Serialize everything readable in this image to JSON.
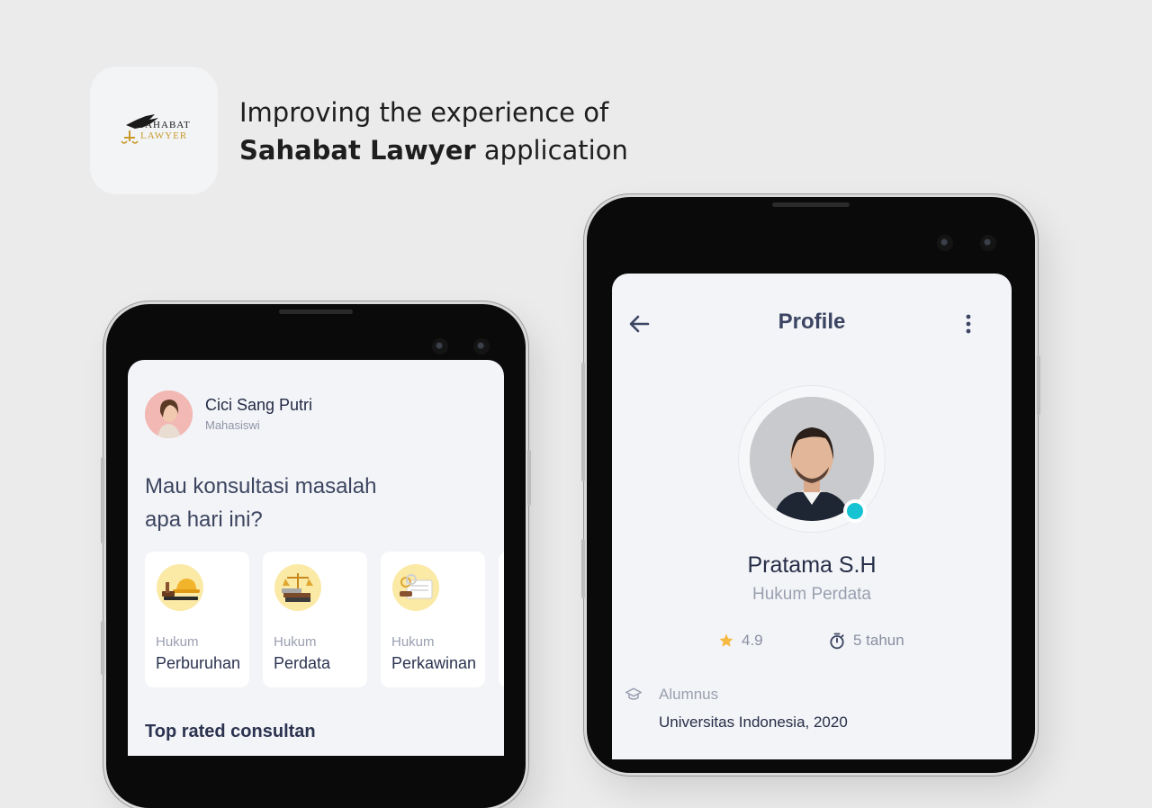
{
  "header": {
    "logo": {
      "top_text": "SAHABAT",
      "bottom_text": "LAWYER"
    },
    "line1": "Improving the experience of",
    "line2_bold": "Sahabat Lawyer",
    "line2_rest": "application"
  },
  "home": {
    "user": {
      "name": "Cici Sang Putri",
      "role": "Mahasiswi"
    },
    "question_line1": "Mau konsultasi masalah",
    "question_line2": "apa hari ini?",
    "categories": [
      {
        "small": "Hukum",
        "title": "Perburuhan",
        "icon": "hardhat-gavel-icon"
      },
      {
        "small": "Hukum",
        "title": "Perdata",
        "icon": "scales-books-icon"
      },
      {
        "small": "Hukum",
        "title": "Perkawinan",
        "icon": "marriage-document-icon"
      }
    ],
    "section_title": "Top rated consultan"
  },
  "profile": {
    "title": "Profile",
    "name": "Pratama S.H",
    "field": "Hukum Perdata",
    "rating": "4.9",
    "experience": "5 tahun",
    "alumnus_label": "Alumnus",
    "alumnus_value": "Universitas Indonesia, 2020"
  },
  "colors": {
    "background": "#ebebeb",
    "screen": "#f3f4f7",
    "category_icon_bg": "#fbe9a6",
    "online": "#15c3d2",
    "star": "#f5b942",
    "logo_gold": "#c79a2a"
  }
}
